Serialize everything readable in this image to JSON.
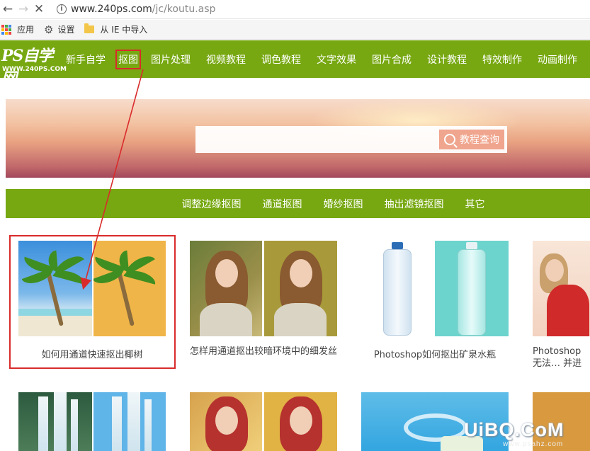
{
  "browser": {
    "url_host": "www.240ps.com",
    "url_path": "/jc/koutu.asp",
    "bookmarks": [
      {
        "label": "应用",
        "icon": "apps-grid-icon"
      },
      {
        "label": "设置",
        "icon": "gear-icon"
      },
      {
        "label": "从 IE 中导入",
        "icon": "folder-icon"
      }
    ]
  },
  "site": {
    "logo_text": "PS自学网",
    "logo_url": "WWW.240PS.COM",
    "nav": [
      "新手自学",
      "抠图",
      "图片处理",
      "视频教程",
      "调色教程",
      "文字效果",
      "图片合成",
      "设计教程",
      "特效制作",
      "动画制作"
    ],
    "active_nav": "抠图"
  },
  "search": {
    "button_label": "教程查询"
  },
  "subnav": [
    "调整边缘抠图",
    "通道抠图",
    "婚纱抠图",
    "抽出滤镜抠图",
    "其它"
  ],
  "articles": [
    {
      "title": "如何用通道快速抠出椰树"
    },
    {
      "title": "怎样用通道抠出较暗环境中的细发丝"
    },
    {
      "title": "Photoshop如何抠出矿泉水瓶"
    },
    {
      "title": "Photoshop无法… 并进"
    }
  ],
  "watermark": {
    "text": "UiBQ.CoM",
    "sub": "www.psahz.com"
  },
  "colors": {
    "brand_green": "#77a811",
    "annotation_red": "#d92b2b"
  }
}
